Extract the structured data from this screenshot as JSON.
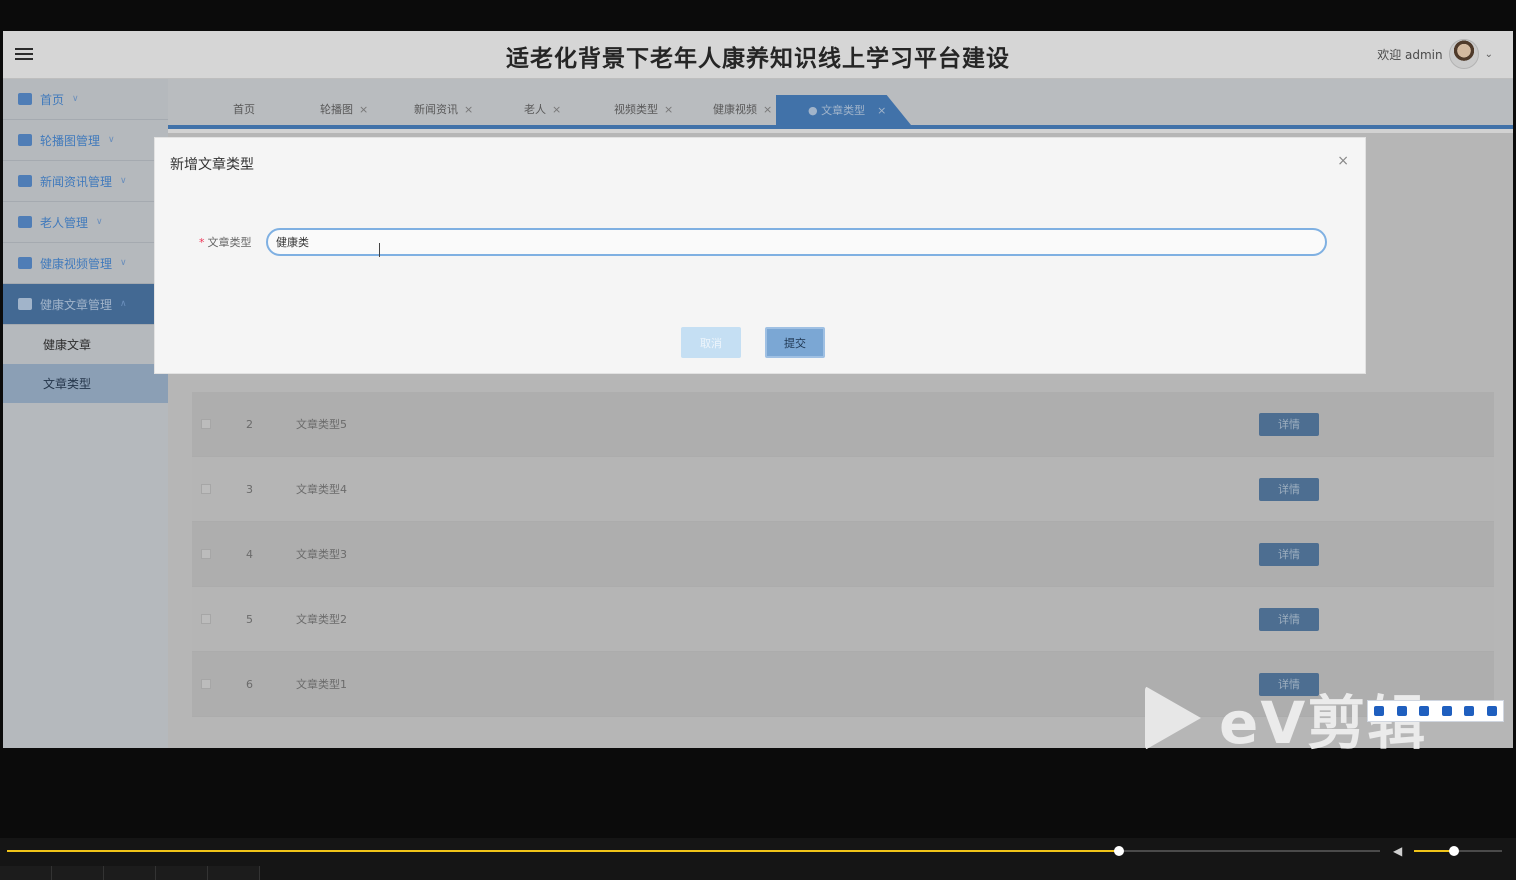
{
  "header": {
    "title": "适老化背景下老年人康养知识线上学习平台建设",
    "user_greeting": "欢迎 admin"
  },
  "sidebar": {
    "items": [
      {
        "label": "首页"
      },
      {
        "label": "轮播图管理"
      },
      {
        "label": "新闻资讯管理"
      },
      {
        "label": "老人管理"
      },
      {
        "label": "健康视频管理"
      },
      {
        "label": "健康文章管理"
      }
    ],
    "subitems": [
      {
        "label": "健康文章"
      },
      {
        "label": "文章类型"
      }
    ]
  },
  "tabs": [
    {
      "label": "首页"
    },
    {
      "label": "轮播图"
    },
    {
      "label": "新闻资讯"
    },
    {
      "label": "老人"
    },
    {
      "label": "视频类型"
    },
    {
      "label": "健康视频"
    },
    {
      "label": "文章类型"
    }
  ],
  "table": {
    "rows": [
      {
        "index": "2",
        "name": "文章类型5",
        "action": "详情"
      },
      {
        "index": "3",
        "name": "文章类型4",
        "action": "详情"
      },
      {
        "index": "4",
        "name": "文章类型3",
        "action": "详情"
      },
      {
        "index": "5",
        "name": "文章类型2",
        "action": "详情"
      },
      {
        "index": "6",
        "name": "文章类型1",
        "action": "详情"
      }
    ]
  },
  "modal": {
    "title": "新增文章类型",
    "close": "×",
    "field_label": "文章类型",
    "required_mark": "*",
    "field_value": "健康类",
    "cancel_label": "取消",
    "submit_label": "提交"
  },
  "watermark": {
    "text": "eV剪辑"
  },
  "player": {
    "progress_fraction": 0.81,
    "volume_fraction": 0.45
  },
  "colors": {
    "accent": "#4a82c1",
    "progress": "#f0c419"
  }
}
